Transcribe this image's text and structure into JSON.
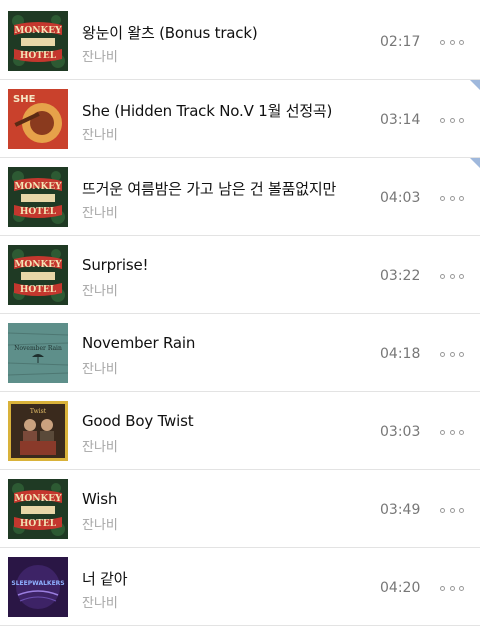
{
  "tracks": [
    {
      "title": "왕눈이 왈츠 (Bonus track)",
      "artist": "잔나비",
      "duration": "02:17",
      "art": "monkey-hotel",
      "highlight": false
    },
    {
      "title": "She (Hidden Track No.V 1월 선정곡)",
      "artist": "잔나비",
      "duration": "03:14",
      "art": "she",
      "highlight": true
    },
    {
      "title": "뜨거운 여름밤은 가고 남은 건 볼품없지만",
      "artist": "잔나비",
      "duration": "04:03",
      "art": "monkey-hotel",
      "highlight": true
    },
    {
      "title": "Surprise!",
      "artist": "잔나비",
      "duration": "03:22",
      "art": "monkey-hotel",
      "highlight": false
    },
    {
      "title": "November Rain",
      "artist": "잔나비",
      "duration": "04:18",
      "art": "november-rain",
      "highlight": false
    },
    {
      "title": "Good Boy Twist",
      "artist": "잔나비",
      "duration": "03:03",
      "art": "good-boy-twist",
      "highlight": false
    },
    {
      "title": "Wish",
      "artist": "잔나비",
      "duration": "03:49",
      "art": "monkey-hotel",
      "highlight": false
    },
    {
      "title": "너 같아",
      "artist": "잔나비",
      "duration": "04:20",
      "art": "sleepwalkers",
      "highlight": false
    }
  ],
  "art_text": {
    "monkey_hotel": [
      "MONKEY",
      "HOTEL"
    ],
    "she": "SHE",
    "november_rain": "November Rain",
    "good_boy_twist": "Twist",
    "sleepwalkers": "SLEEPWALKERS"
  }
}
